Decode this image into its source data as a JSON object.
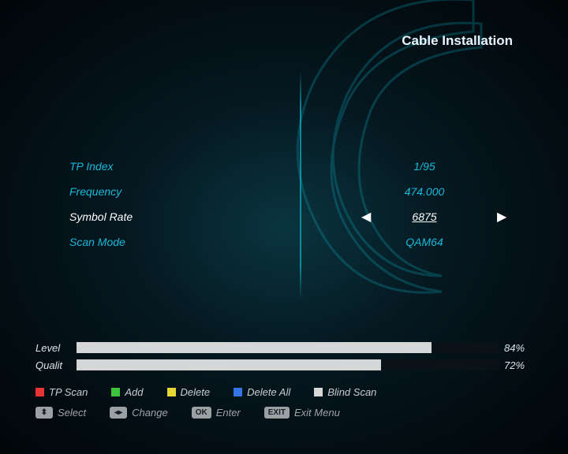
{
  "title": "Cable Installation",
  "settings": {
    "tp_index": {
      "label": "TP Index",
      "value": "1/95"
    },
    "frequency": {
      "label": "Frequency",
      "value": "474.000"
    },
    "symbol_rate": {
      "label": "Symbol Rate",
      "value": "6875"
    },
    "scan_mode": {
      "label": "Scan Mode",
      "value": "QAM64"
    }
  },
  "signal": {
    "level": {
      "label": "Level",
      "pct": 84,
      "text": "84%"
    },
    "quality": {
      "label": "Qualit",
      "pct": 72,
      "text": "72%"
    }
  },
  "actions": {
    "tp_scan": "TP Scan",
    "add": "Add",
    "delete": "Delete",
    "delete_all": "Delete All",
    "blind_scan": "Blind Scan"
  },
  "hints": {
    "select": {
      "key": "⬍",
      "label": "Select"
    },
    "change": {
      "key": "◂▸",
      "label": "Change"
    },
    "enter": {
      "key": "OK",
      "label": "Enter"
    },
    "exit": {
      "key": "EXIT",
      "label": "Exit Menu"
    }
  }
}
